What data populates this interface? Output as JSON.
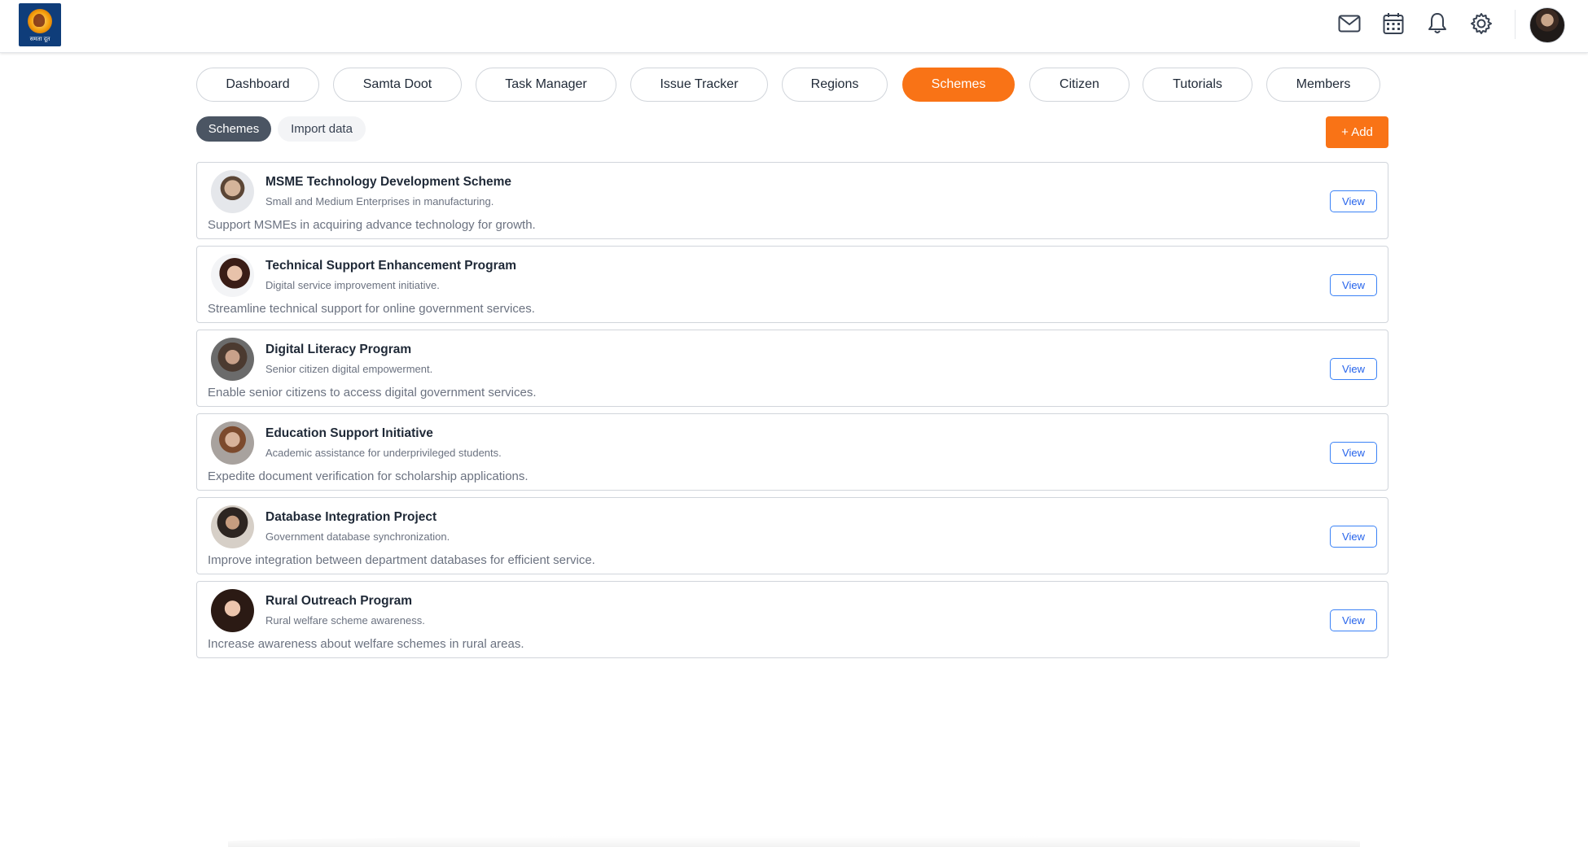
{
  "app": {
    "logo_text": "समता दूत",
    "logo_icon": "samta-doot-logo"
  },
  "header": {
    "icons": [
      "mail-icon",
      "calendar-icon",
      "bell-icon",
      "gear-icon"
    ],
    "avatar": "user-avatar"
  },
  "nav": {
    "active": "Schemes",
    "tabs": [
      {
        "label": "Dashboard"
      },
      {
        "label": "Samta Doot"
      },
      {
        "label": "Task Manager"
      },
      {
        "label": "Issue Tracker"
      },
      {
        "label": "Regions"
      },
      {
        "label": "Schemes"
      },
      {
        "label": "Citizen"
      },
      {
        "label": "Tutorials"
      },
      {
        "label": "Members"
      }
    ]
  },
  "subtabs": {
    "active": "Schemes",
    "items": [
      {
        "label": "Schemes"
      },
      {
        "label": "Import data"
      }
    ]
  },
  "add_button": {
    "label": "+ Add"
  },
  "colors": {
    "accent": "#f97316",
    "subtab_active": "#4b5563",
    "view_button": "#2563eb"
  },
  "schemes": [
    {
      "title": "MSME Technology Development Scheme",
      "subtitle": "Small and Medium Enterprises in manufacturing.",
      "description": "Support MSMEs in acquiring advance technology for growth.",
      "view_label": "View"
    },
    {
      "title": "Technical Support Enhancement Program",
      "subtitle": "Digital service improvement initiative.",
      "description": "Streamline technical support for online government services.",
      "view_label": "View"
    },
    {
      "title": "Digital Literacy Program",
      "subtitle": "Senior citizen digital empowerment.",
      "description": "Enable senior citizens to access digital government services.",
      "view_label": "View"
    },
    {
      "title": "Education Support Initiative",
      "subtitle": "Academic assistance for underprivileged students.",
      "description": "Expedite document verification for scholarship applications.",
      "view_label": "View"
    },
    {
      "title": "Database Integration Project",
      "subtitle": "Government database synchronization.",
      "description": "Improve integration between department databases for efficient service.",
      "view_label": "View"
    },
    {
      "title": "Rural Outreach Program",
      "subtitle": "Rural welfare scheme awareness.",
      "description": "Increase awareness about welfare schemes in rural areas.",
      "view_label": "View"
    }
  ]
}
